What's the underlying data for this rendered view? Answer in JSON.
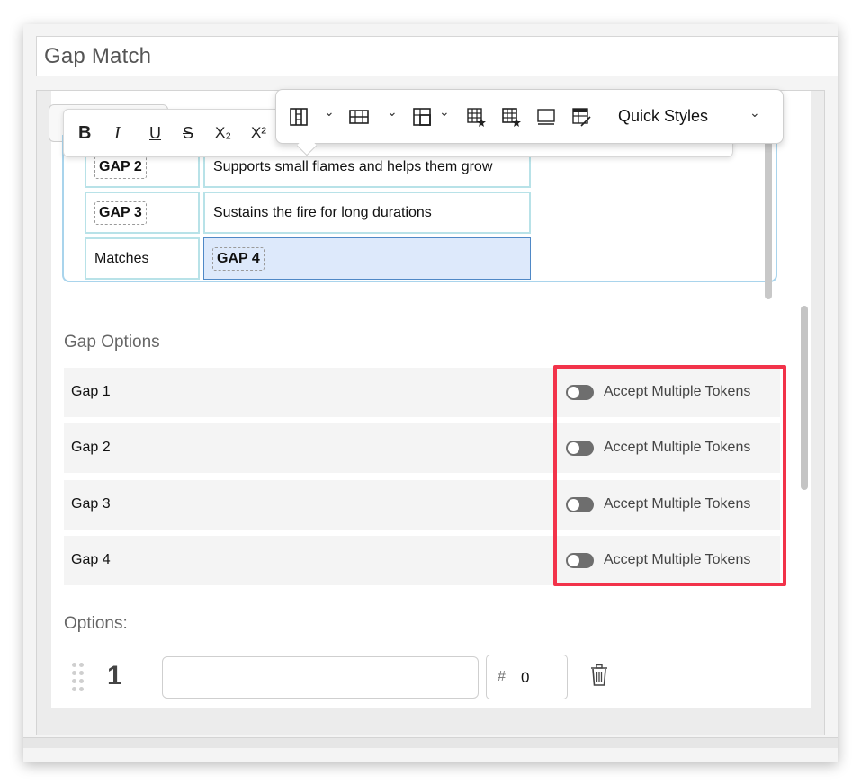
{
  "title_field": {
    "value": "Gap Match"
  },
  "format_toolbar": {
    "bold": "B",
    "italic": "I",
    "underline": "U",
    "strikethrough": "S",
    "subscript": "X₂",
    "superscript": "X²"
  },
  "table_toolbar": {
    "quick_styles_label": "Quick Styles",
    "icons": [
      "table-column-icon",
      "table-row-icon",
      "table-cell-icon",
      "table-cell-style-icon",
      "table-style-icon",
      "table-header-icon",
      "table-edit-icon"
    ]
  },
  "editor_table": {
    "rows": [
      {
        "left_token": "GAP 2",
        "right": "Supports small flames and helps them grow"
      },
      {
        "left_token": "GAP 3",
        "right": "Sustains the fire for long durations"
      },
      {
        "left": "Matches",
        "right_token": "GAP 4"
      }
    ]
  },
  "gap_options": {
    "label": "Gap Options",
    "rows": [
      {
        "name": "Gap 1",
        "toggle_label": "Accept Multiple Tokens",
        "enabled": false
      },
      {
        "name": "Gap 2",
        "toggle_label": "Accept Multiple Tokens",
        "enabled": false
      },
      {
        "name": "Gap 3",
        "toggle_label": "Accept Multiple Tokens",
        "enabled": false
      },
      {
        "name": "Gap 4",
        "toggle_label": "Accept Multiple Tokens",
        "enabled": false
      }
    ]
  },
  "options": {
    "label": "Options:",
    "items": [
      {
        "number": "1",
        "value": "",
        "score_symbol": "#",
        "score": "0"
      }
    ]
  },
  "colors": {
    "highlight": "#f2334a",
    "toggle_off": "#6e6e6e",
    "table_border": "#b8e2e8",
    "selected_cell": "#dde9fb"
  }
}
